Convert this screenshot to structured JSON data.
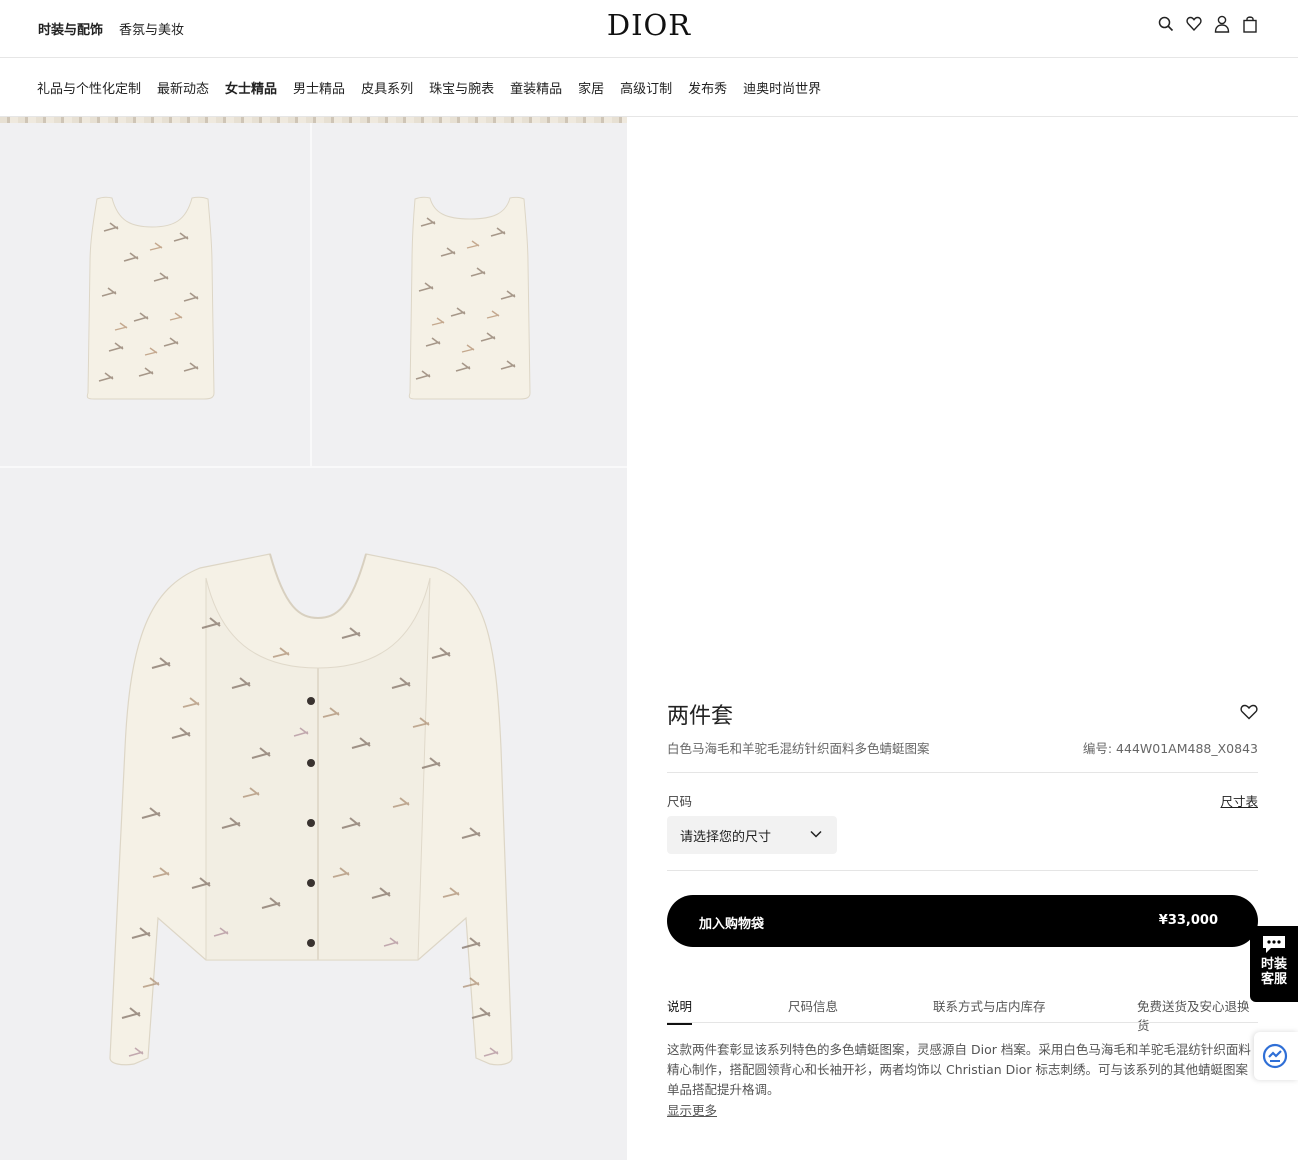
{
  "header": {
    "top_links": [
      "时装与配饰",
      "香氛与美妆"
    ],
    "logo": "DIOR",
    "icons": [
      "search-icon",
      "heart-icon",
      "user-icon",
      "bag-icon"
    ]
  },
  "nav": {
    "items": [
      "礼品与个性化定制",
      "最新动态",
      "女士精品",
      "男士精品",
      "皮具系列",
      "珠宝与腕表",
      "童装精品",
      "家居",
      "高级订制",
      "发布秀",
      "迪奥时尚世界"
    ]
  },
  "product": {
    "title": "两件套",
    "subtitle": "白色马海毛和羊驼毛混纺针织面料多色蜻蜓图案",
    "reference": "编号: 444W01AM488_X0843",
    "size_label": "尺码",
    "size_chart": "尺寸表",
    "size_placeholder": "请选择您的尺寸",
    "add_to_bag": "加入购物袋",
    "price": "¥33,000",
    "tabs": [
      "说明",
      "尺码信息",
      "联系方式与店内库存",
      "免费送货及安心退换货"
    ],
    "description": "这款两件套彰显该系列特色的多色蜻蜓图案，灵感源自 Dior 档案。采用白色马海毛和羊驼毛混纺针织面料精心制作，搭配圆领背心和长袖开衫，两者均饰以 Christian Dior 标志刺绣。可与该系列的其他蜻蜓图案单品搭配提升格调。",
    "show_more": "显示更多"
  },
  "chat": {
    "label": "时装客服"
  },
  "colors": {
    "accent": "#000000",
    "image_bg": "#f0f0f2",
    "garment": "#f5f1e6"
  }
}
